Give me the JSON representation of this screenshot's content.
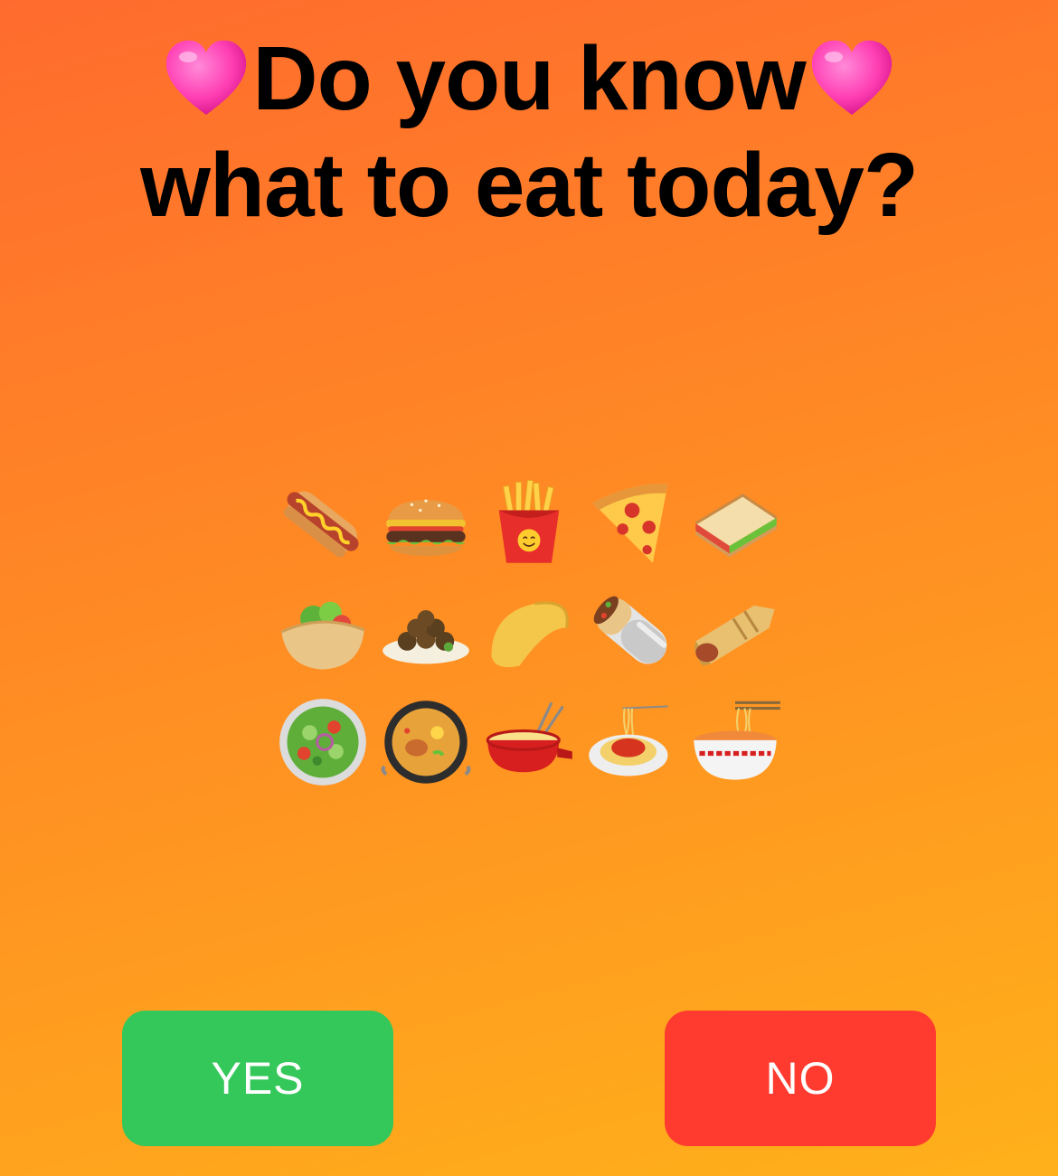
{
  "title": {
    "line1": "Do you know",
    "line2": "what to eat today?",
    "heart_icon": "pink-heart-icon",
    "heart_color": "#ff3fb4"
  },
  "food_grid": {
    "rows": [
      [
        "hot-dog-icon",
        "hamburger-icon",
        "french-fries-icon",
        "pizza-icon",
        "sandwich-icon"
      ],
      [
        "stuffed-flatbread-icon",
        "falafel-icon",
        "taco-icon",
        "burrito-icon",
        "tamale-icon"
      ],
      [
        "green-salad-icon",
        "shallow-pan-of-food-icon",
        "fondue-icon",
        "spaghetti-icon",
        "steaming-bowl-icon"
      ]
    ]
  },
  "buttons": {
    "yes": {
      "label": "YES",
      "color": "#34c759"
    },
    "no": {
      "label": "NO",
      "color": "#ff3b30"
    }
  }
}
